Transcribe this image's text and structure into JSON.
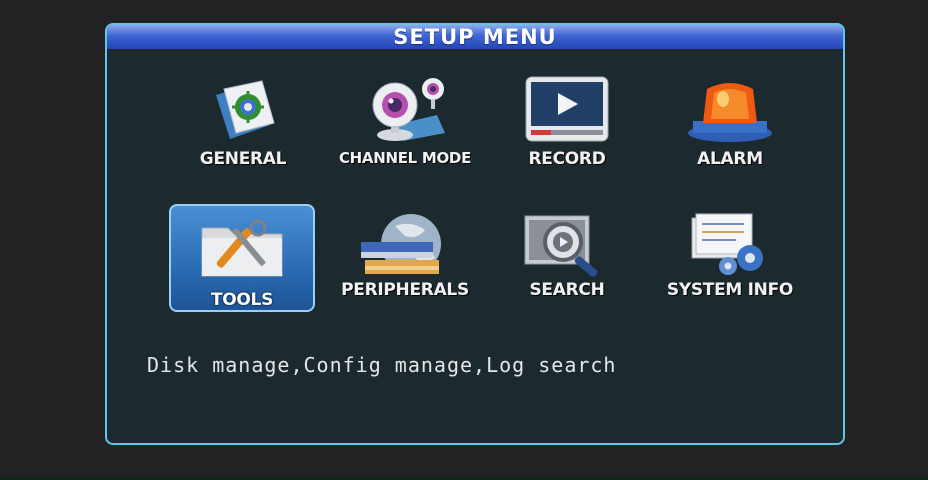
{
  "menu": {
    "title": "SETUP  MENU",
    "items": [
      {
        "label": "GENERAL",
        "icon": "gear-document-icon"
      },
      {
        "label": "CHANNEL MODE",
        "icon": "webcam-icon"
      },
      {
        "label": "RECORD",
        "icon": "video-player-icon"
      },
      {
        "label": "ALARM",
        "icon": "siren-light-icon"
      },
      {
        "label": "TOOLS",
        "icon": "tools-folder-icon",
        "selected": true
      },
      {
        "label": "PERIPHERALS",
        "icon": "globe-devices-icon"
      },
      {
        "label": "SEARCH",
        "icon": "magnifier-video-icon"
      },
      {
        "label": "SYSTEM INFO",
        "icon": "document-gears-icon"
      }
    ],
    "description": "Disk manage,Config manage,Log search"
  },
  "colors": {
    "panel_border": "#5fc6e6",
    "title_bar": "#3f64d2",
    "selected_item": "#2a6cb6"
  }
}
